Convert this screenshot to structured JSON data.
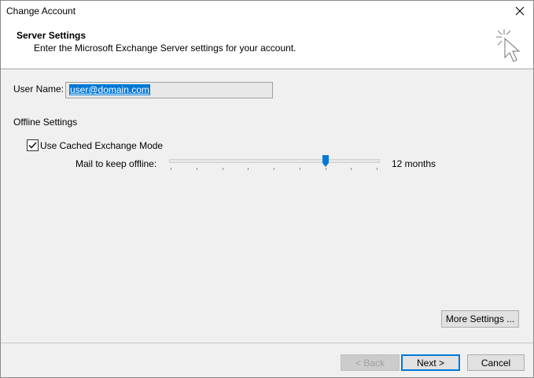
{
  "window": {
    "title": "Change Account"
  },
  "header": {
    "title": "Server Settings",
    "subtitle": "Enter the Microsoft Exchange Server settings for your account."
  },
  "user": {
    "label": "User Name:",
    "value": "user@domain.com"
  },
  "offline": {
    "section_label": "Offline Settings",
    "cached_mode_label": "Use Cached Exchange Mode",
    "cached_mode_checked": true,
    "mail_keep_label": "Mail to keep offline:",
    "mail_keep_value": "12 months",
    "slider_position_fraction": 0.75
  },
  "buttons": {
    "more_settings": "More Settings ...",
    "back": "< Back",
    "next": "Next >",
    "cancel": "Cancel"
  },
  "colors": {
    "accent": "#0078d7",
    "dialog_bg": "#f0f0f0"
  },
  "icons": [
    "close-icon",
    "cursor-sparkle-icon",
    "checkmark-icon",
    "slider-thumb"
  ]
}
